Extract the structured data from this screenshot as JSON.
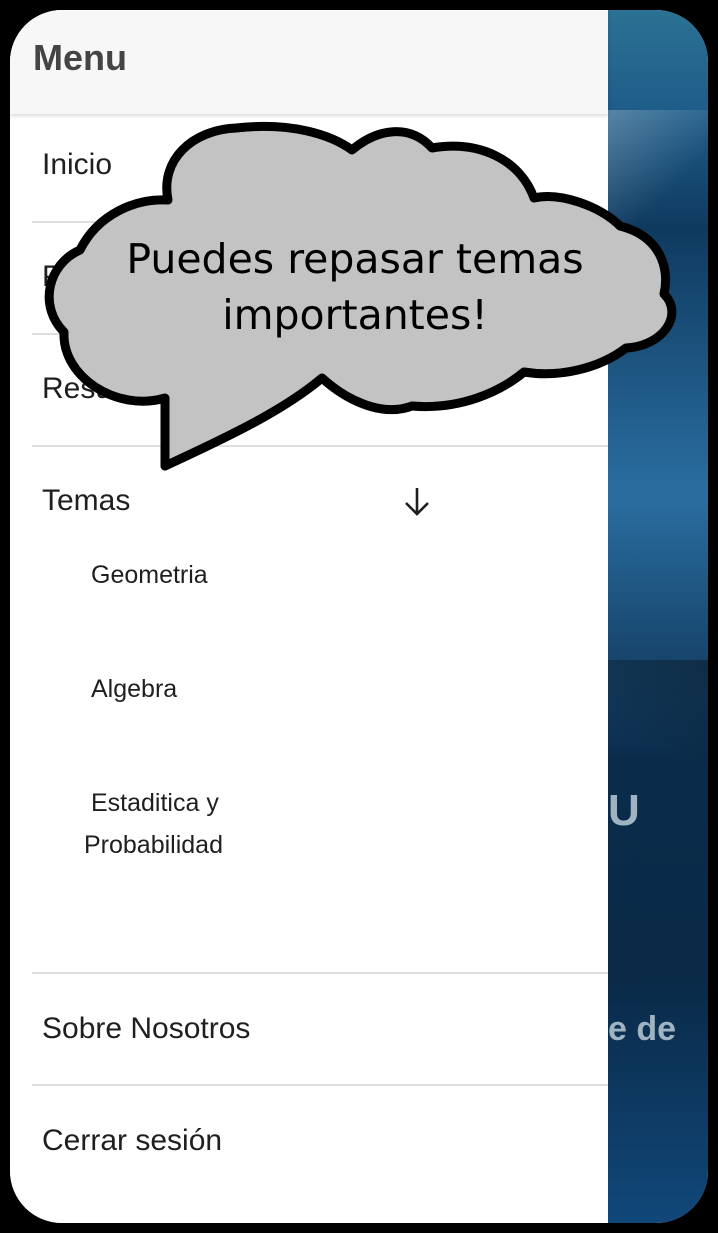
{
  "drawer": {
    "title": "Menu",
    "items": [
      {
        "label": "Inicio"
      },
      {
        "label": "P"
      },
      {
        "label": "Resultad"
      },
      {
        "label": "Temas"
      },
      {
        "label": "Sobre Nosotros"
      },
      {
        "label": "Cerrar sesión"
      }
    ],
    "subitems": [
      {
        "label": "Geometria"
      },
      {
        "label": "Algebra"
      },
      {
        "label": "Estaditica y"
      },
      {
        "label": "Probabilidad"
      }
    ]
  },
  "background": {
    "text1": "U",
    "text2": "e de"
  },
  "bubble": {
    "line1": "Puedes repasar temas",
    "line2": "importantes!"
  },
  "colors": {
    "accent_blue": "#1f5d8a",
    "bubble_fill": "#c3c3c3"
  }
}
